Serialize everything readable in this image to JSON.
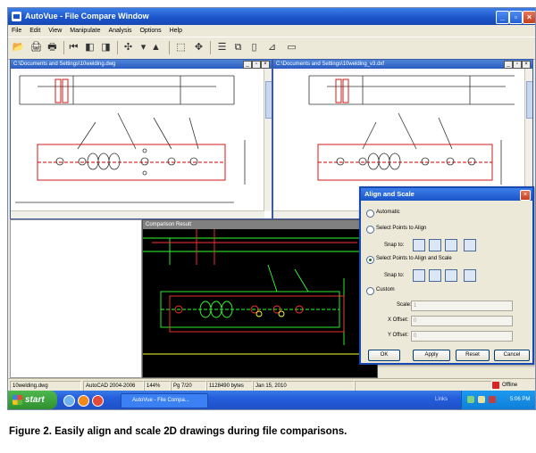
{
  "window": {
    "title": "AutoVue - File Compare Window"
  },
  "menu": [
    "File",
    "Edit",
    "View",
    "Manipulate",
    "Analysis",
    "Options",
    "Help"
  ],
  "panes": {
    "left": {
      "title": "C:\\Documents and Settings\\10welding.dwg"
    },
    "right": {
      "title": "C:\\Documents and Settings\\10welding_v3.dxf"
    },
    "result": {
      "title": "Comparison Result"
    }
  },
  "dialog": {
    "title": "Align and Scale",
    "options": {
      "automatic": "Automatic",
      "select_align": "Select Points to Align",
      "select_align_scale": "Select Points to Align and Scale",
      "custom": "Custom"
    },
    "snap_label": "Snap to:",
    "fields": {
      "scale": {
        "label": "Scale:",
        "value": "1"
      },
      "x_offset": {
        "label": "X Offset:",
        "value": "0"
      },
      "y_offset": {
        "label": "Y Offset:",
        "value": "0"
      }
    },
    "buttons": {
      "ok": "OK",
      "apply": "Apply",
      "reset": "Reset",
      "cancel": "Cancel"
    },
    "selected": "select_align_scale"
  },
  "status": {
    "file": "10welding.dwg",
    "format": "AutoCAD 2004-2006",
    "zoom": "144%",
    "page": "Pg 7/20",
    "size": "1128490 bytes",
    "date": "Jan 15, 2010",
    "offline": "Offline"
  },
  "taskbar": {
    "start": "start",
    "task": "AutoVue - File Compa...",
    "links": "Links",
    "clock": "5:06 PM"
  },
  "caption": "Figure 2.  Easily align and scale 2D drawings during file comparisons.",
  "colors": {
    "xp_blue": "#245ddb",
    "drawing_red": "#cc0000",
    "result_bg": "#000000",
    "result_green": "#33ff33",
    "start_green": "#2f8f2f"
  }
}
